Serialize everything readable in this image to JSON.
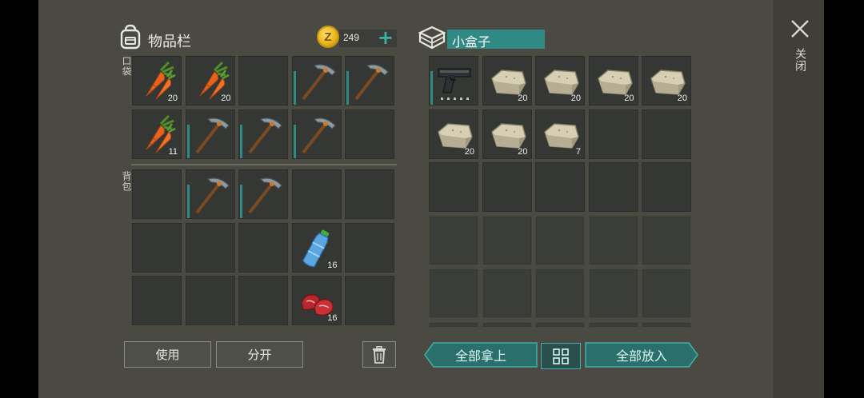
{
  "inventory": {
    "title": "物品栏",
    "pocket_label": "口袋",
    "backpack_label": "背包",
    "coins": "249",
    "coin_symbol": "Z",
    "pocket": [
      {
        "item": "carrot",
        "qty": "20"
      },
      {
        "item": "carrot",
        "qty": "20"
      },
      {
        "item": "",
        "qty": ""
      },
      {
        "item": "pickaxe",
        "qty": "",
        "bar": true
      },
      {
        "item": "pickaxe",
        "qty": "",
        "bar": true
      },
      {
        "item": "carrot",
        "qty": "11"
      },
      {
        "item": "pickaxe",
        "qty": "",
        "bar": true
      },
      {
        "item": "pickaxe",
        "qty": "",
        "bar": true
      },
      {
        "item": "pickaxe",
        "qty": "",
        "bar": true
      },
      {
        "item": "",
        "qty": ""
      }
    ],
    "backpack": [
      {
        "item": "",
        "qty": ""
      },
      {
        "item": "pickaxe",
        "qty": "",
        "bar": true
      },
      {
        "item": "pickaxe",
        "qty": "",
        "bar": true
      },
      {
        "item": "",
        "qty": ""
      },
      {
        "item": "",
        "qty": ""
      },
      {
        "item": "",
        "qty": ""
      },
      {
        "item": "",
        "qty": ""
      },
      {
        "item": "",
        "qty": ""
      },
      {
        "item": "water-bottle",
        "qty": "16"
      },
      {
        "item": "",
        "qty": ""
      },
      {
        "item": "",
        "qty": ""
      },
      {
        "item": "",
        "qty": ""
      },
      {
        "item": "",
        "qty": ""
      },
      {
        "item": "raw-meat",
        "qty": "16"
      },
      {
        "item": "",
        "qty": ""
      }
    ],
    "use_label": "使用",
    "split_label": "分开"
  },
  "container": {
    "title": "小盒子",
    "slots": [
      {
        "item": "pistol",
        "qty": "",
        "bar": true
      },
      {
        "item": "stone",
        "qty": "20"
      },
      {
        "item": "stone",
        "qty": "20"
      },
      {
        "item": "stone",
        "qty": "20"
      },
      {
        "item": "stone",
        "qty": "20"
      },
      {
        "item": "stone",
        "qty": "20"
      },
      {
        "item": "stone",
        "qty": "20"
      },
      {
        "item": "stone",
        "qty": "7"
      },
      {
        "item": "",
        "qty": ""
      },
      {
        "item": "",
        "qty": ""
      },
      {
        "item": "",
        "qty": ""
      },
      {
        "item": "",
        "qty": ""
      },
      {
        "item": "",
        "qty": ""
      },
      {
        "item": "",
        "qty": ""
      },
      {
        "item": "",
        "qty": ""
      }
    ],
    "locked_rows": 3,
    "take_all_label": "全部拿上",
    "put_all_label": "全部放入"
  },
  "close_label": "关闭",
  "colors": {
    "accent": "#2f8a86",
    "panel": "#4a4a42",
    "slot": "#343733",
    "coin": "#e8b21a"
  }
}
